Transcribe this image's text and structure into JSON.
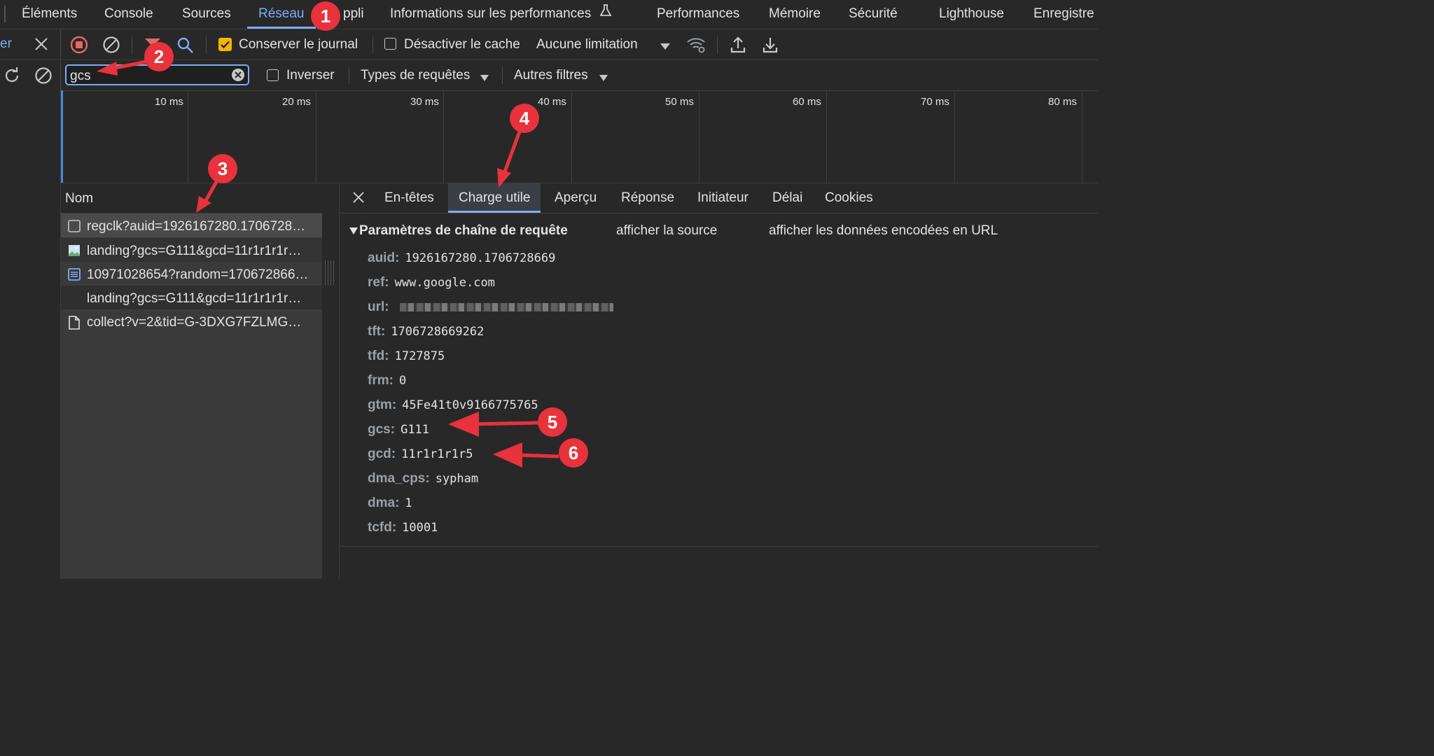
{
  "tabs": [
    "Éléments",
    "Console",
    "Sources",
    "Réseau",
    "ppli",
    "Informations sur les performances",
    "Performances",
    "Mémoire",
    "Sécurité",
    "Lighthouse",
    "Enregistre"
  ],
  "active_tab": "Réseau",
  "left_panel_fragment": "er",
  "toolbar": {
    "preserve_log": "Conserver le journal",
    "disable_cache": "Désactiver le cache",
    "throttling": "Aucune limitation"
  },
  "filter": {
    "value": "gcs",
    "invert": "Inverser",
    "request_types": "Types de requêtes",
    "more_filters": "Autres filtres"
  },
  "timeline": {
    "ticks": [
      "10 ms",
      "20 ms",
      "30 ms",
      "40 ms",
      "50 ms",
      "60 ms",
      "70 ms",
      "80 ms"
    ]
  },
  "requests": {
    "header": "Nom",
    "items": [
      {
        "name": "regclk?auid=1926167280.1706728…",
        "icon": "checkbox-icon"
      },
      {
        "name": "landing?gcs=G111&gcd=11r1r1r1r…",
        "icon": "image-icon"
      },
      {
        "name": "10971028654?random=170672866…",
        "icon": "document-icon"
      },
      {
        "name": "landing?gcs=G111&gcd=11r1r1r1r…",
        "icon": ""
      },
      {
        "name": "collect?v=2&tid=G-3DXG7FZLMG…",
        "icon": "file-icon"
      }
    ]
  },
  "details": {
    "tabs": [
      "En-têtes",
      "Charge utile",
      "Aperçu",
      "Réponse",
      "Initiateur",
      "Délai",
      "Cookies"
    ],
    "active_tab": "Charge utile",
    "section_title": "Paramètres de chaîne de requête",
    "view_source": "afficher la source",
    "view_url_encoded": "afficher les données encodées en URL",
    "params": [
      {
        "key": "auid:",
        "value": "1926167280.1706728669"
      },
      {
        "key": "ref:",
        "value": "www.google.com"
      },
      {
        "key": "url:",
        "value": ""
      },
      {
        "key": "tft:",
        "value": "1706728669262"
      },
      {
        "key": "tfd:",
        "value": "1727875"
      },
      {
        "key": "frm:",
        "value": "0"
      },
      {
        "key": "gtm:",
        "value": "45Fe41t0v9166775765"
      },
      {
        "key": "gcs:",
        "value": "G111"
      },
      {
        "key": "gcd:",
        "value": "11r1r1r1r5"
      },
      {
        "key": "dma_cps:",
        "value": "sypham"
      },
      {
        "key": "dma:",
        "value": "1"
      },
      {
        "key": "tcfd:",
        "value": "10001"
      }
    ]
  },
  "annotations": [
    "1",
    "2",
    "3",
    "4",
    "5",
    "6"
  ],
  "colors": {
    "accent": "#7cacf8",
    "annotation": "#e8323c",
    "record": "#e46962",
    "checkbox": "#f4b400"
  }
}
